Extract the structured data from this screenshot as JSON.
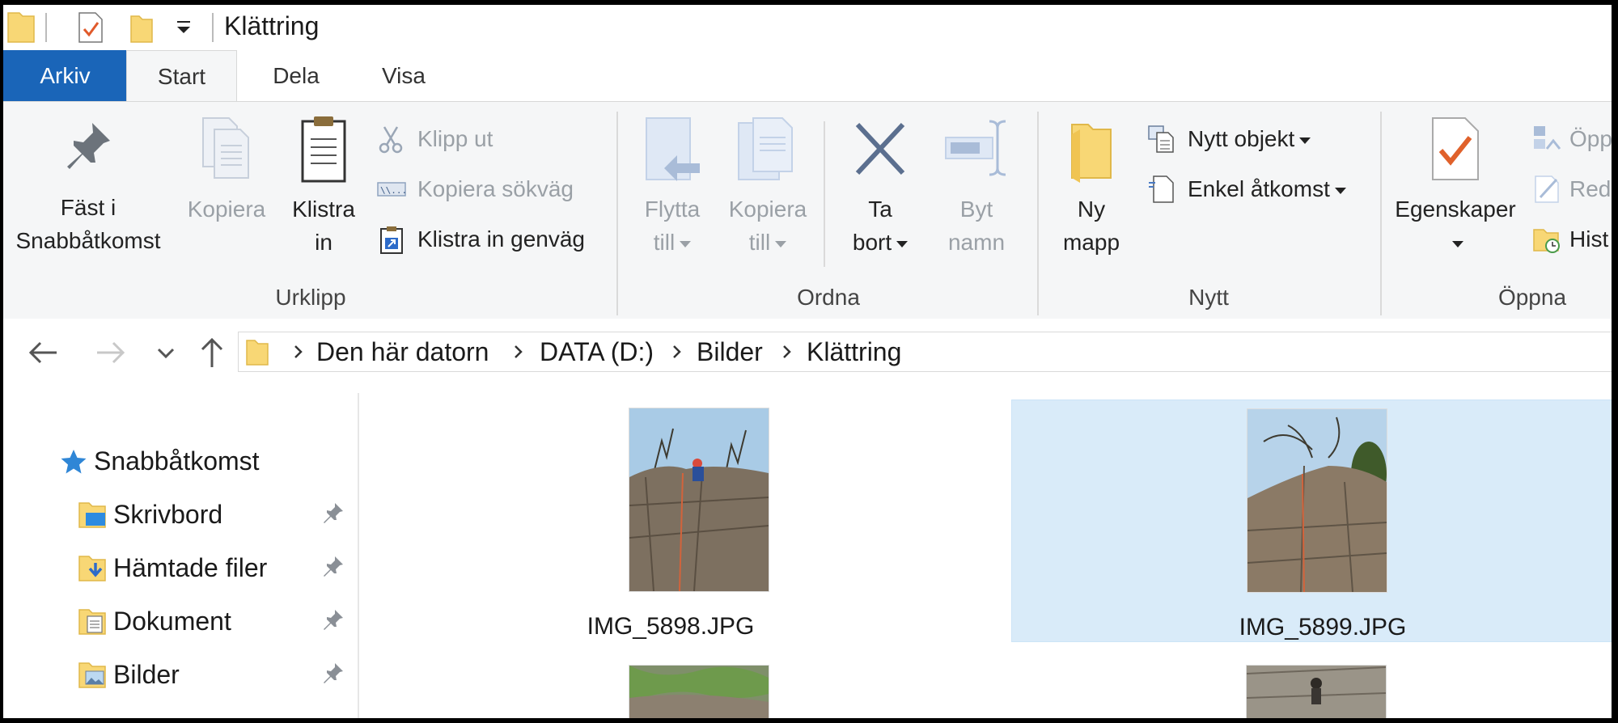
{
  "window": {
    "title": "Klättring"
  },
  "ribbon_tabs": [
    "Arkiv",
    "Start",
    "Dela",
    "Visa"
  ],
  "ribbon": {
    "urklipp": {
      "pin": [
        "Fäst i",
        "Snabbåtkomst"
      ],
      "copy": "Kopiera",
      "paste": [
        "Klistra",
        "in"
      ],
      "cut": "Klipp ut",
      "copy_path": "Kopiera sökväg",
      "paste_shortcut": "Klistra in genväg",
      "group": "Urklipp"
    },
    "ordna": {
      "move": [
        "Flytta",
        "till"
      ],
      "copy_to": [
        "Kopiera",
        "till"
      ],
      "delete": [
        "Ta",
        "bort"
      ],
      "rename": [
        "Byt",
        "namn"
      ],
      "group": "Ordna"
    },
    "nytt": {
      "new_folder": [
        "Ny",
        "mapp"
      ],
      "new_item": "Nytt objekt",
      "easy_access": "Enkel åtkomst",
      "group": "Nytt"
    },
    "oppna": {
      "properties": "Egenskaper",
      "open": "Öpp",
      "edit": "Redi",
      "history": "Hist",
      "group": "Öppna"
    }
  },
  "breadcrumb": [
    "Den här datorn",
    "DATA (D:)",
    "Bilder",
    "Klättring"
  ],
  "nav_pane": {
    "quick_access": "Snabbåtkomst",
    "items": [
      {
        "label": "Skrivbord",
        "icon": "desktop-folder-icon"
      },
      {
        "label": "Hämtade filer",
        "icon": "downloads-folder-icon"
      },
      {
        "label": "Dokument",
        "icon": "documents-folder-icon"
      },
      {
        "label": "Bilder",
        "icon": "pictures-folder-icon"
      }
    ]
  },
  "files": [
    {
      "name": "IMG_5898.JPG",
      "selected": false
    },
    {
      "name": "IMG_5899.JPG",
      "selected": true
    }
  ],
  "colors": {
    "file_tab": "#1a65b8",
    "selection": "#d9ebf9",
    "folder": "#f8d775"
  }
}
